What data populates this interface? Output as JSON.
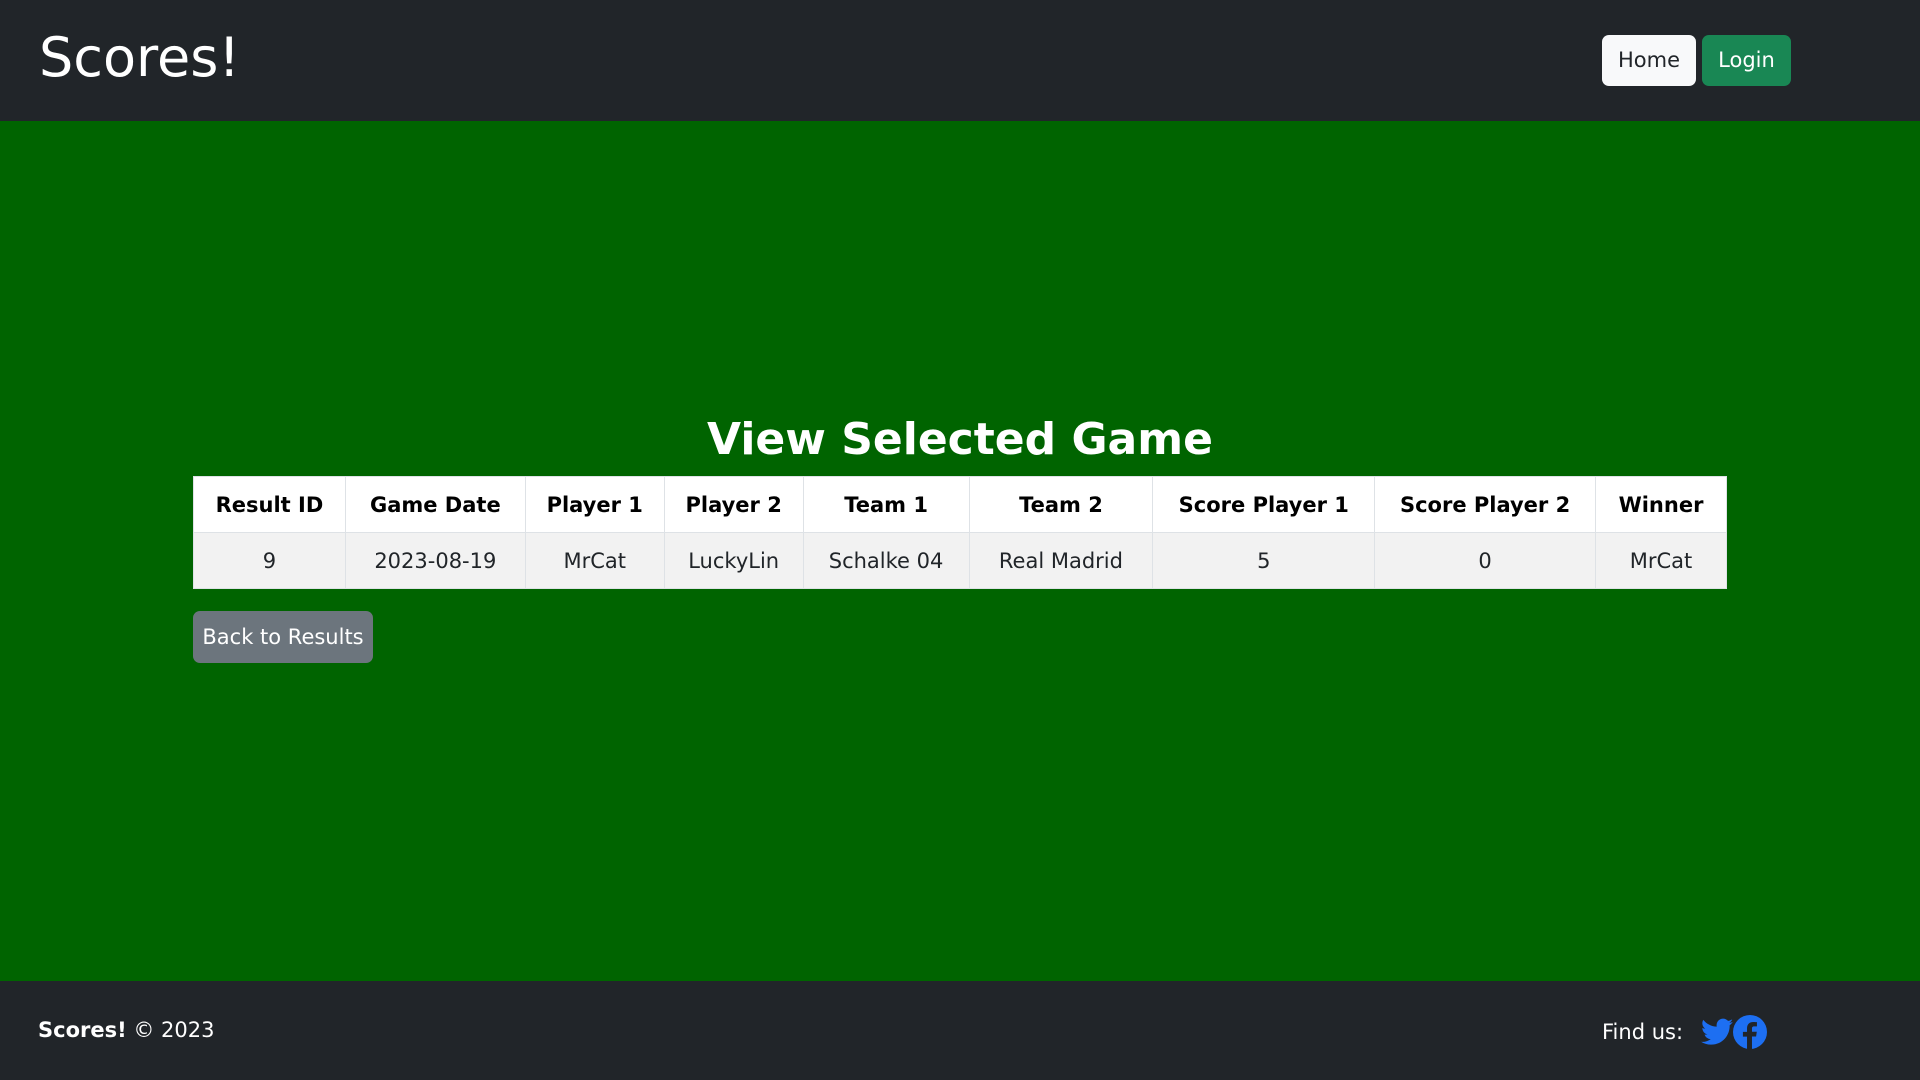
{
  "header": {
    "brand": "Scores!",
    "nav": {
      "home_label": "Home",
      "login_label": "Login"
    }
  },
  "main": {
    "title": "View Selected Game",
    "table": {
      "columns": [
        "Result ID",
        "Game Date",
        "Player 1",
        "Player 2",
        "Team 1",
        "Team 2",
        "Score Player 1",
        "Score Player 2",
        "Winner"
      ],
      "rows": [
        [
          "9",
          "2023-08-19",
          "MrCat",
          "LuckyLin",
          "Schalke 04",
          "Real Madrid",
          "5",
          "0",
          "MrCat"
        ]
      ]
    },
    "back_button_label": "Back to Results"
  },
  "footer": {
    "brand": "Scores!",
    "copyright": "© 2023",
    "find_us_label": "Find us:",
    "social_icons": [
      "twitter-icon",
      "facebook-icon"
    ]
  },
  "colors": {
    "page_background": "#006400",
    "navbar": "#212529",
    "login_button": "#198754",
    "back_button": "#6c757d",
    "social_icon": "#1d6ff2"
  }
}
